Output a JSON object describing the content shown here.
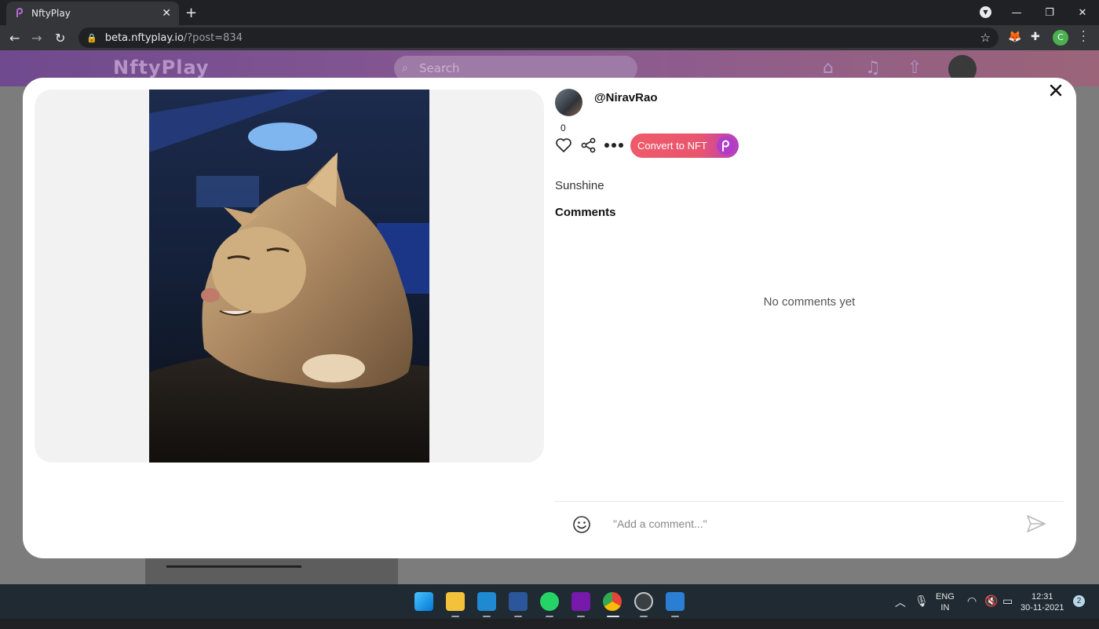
{
  "browser": {
    "tab_title": "NftyPlay",
    "url_host": "beta.nftyplay.io",
    "url_path": "/?post=834"
  },
  "site": {
    "logo": "NftyPlay",
    "search_placeholder": "Search"
  },
  "post": {
    "author": "@NiravRao",
    "like_count": "0",
    "convert_button": "Convert to NFT",
    "caption": "Sunshine",
    "comments_title": "Comments",
    "empty_comments": "No comments yet",
    "comment_placeholder": "\"Add a comment...\""
  },
  "taskbar": {
    "lang_line1": "ENG",
    "lang_line2": "IN",
    "time": "12:31",
    "date": "30-11-2021",
    "notifications": "2",
    "profile_initial": "C"
  },
  "colors": {
    "accent_start": "#ef5a6a",
    "accent_end": "#b33fc4",
    "header_purple": "#6f4a8e"
  }
}
